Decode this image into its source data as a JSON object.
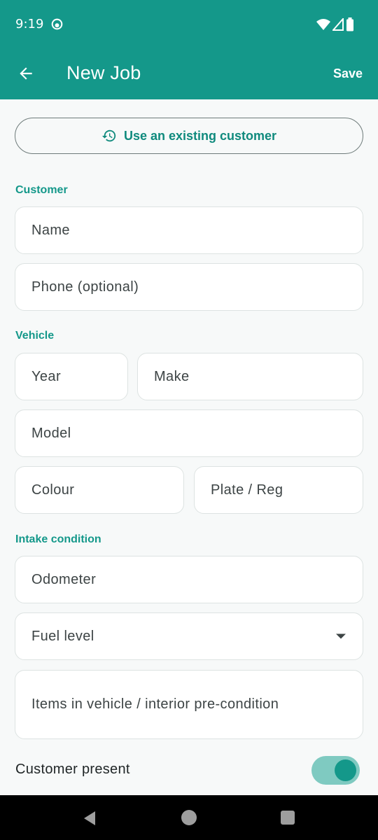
{
  "status": {
    "time": "9:19"
  },
  "appbar": {
    "title": "New Job",
    "save_label": "Save"
  },
  "existing_customer": {
    "label": "Use an existing customer"
  },
  "sections": {
    "customer": "Customer",
    "vehicle": "Vehicle",
    "intake": "Intake condition"
  },
  "fields": {
    "name": "Name",
    "phone": "Phone (optional)",
    "year": "Year",
    "make": "Make",
    "model": "Model",
    "colour": "Colour",
    "plate": "Plate / Reg",
    "odometer": "Odometer",
    "fuel_level": "Fuel level",
    "items": "Items in vehicle / interior pre-condition"
  },
  "toggle": {
    "label": "Customer present",
    "on": true
  },
  "colors": {
    "primary": "#14988a",
    "toggle_track": "#7fcac1"
  },
  "icons": [
    "back-arrow-icon",
    "history-icon",
    "wifi-icon",
    "signal-icon",
    "battery-icon",
    "dropdown-icon"
  ]
}
